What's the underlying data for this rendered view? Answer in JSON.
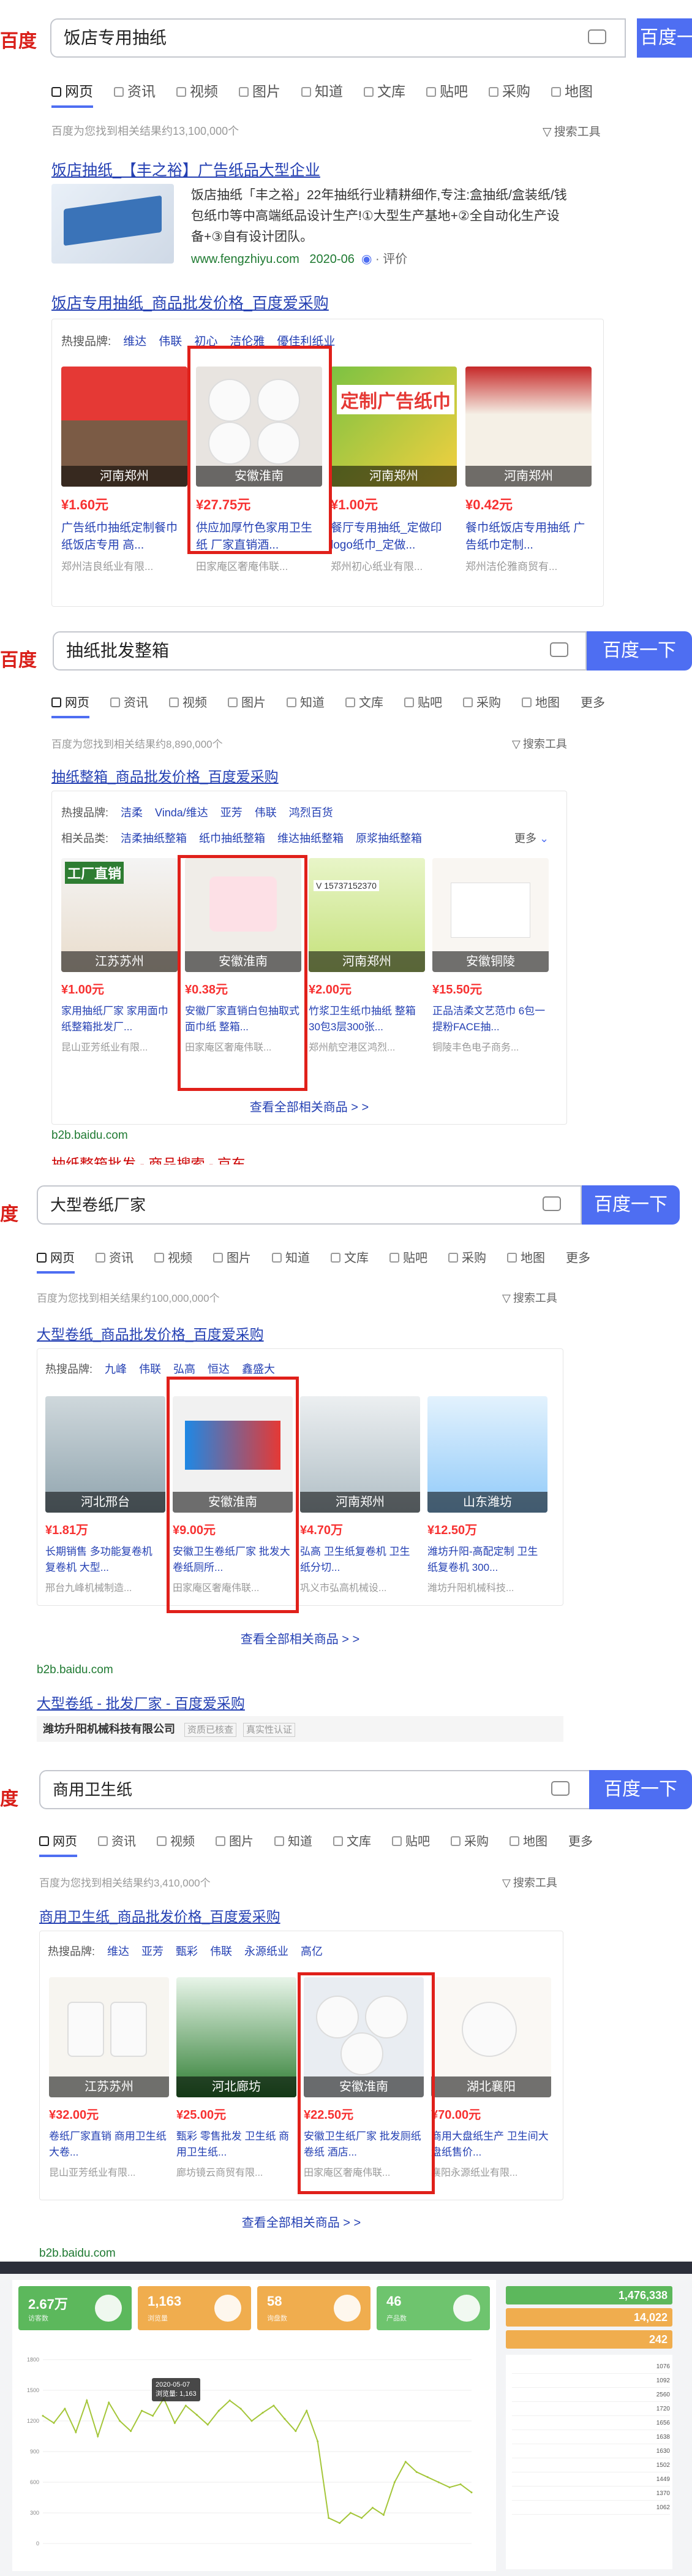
{
  "s1": {
    "logo": "百度",
    "query": "饭店专用抽纸",
    "button": "百度一",
    "tabs": [
      "网页",
      "资讯",
      "视频",
      "图片",
      "知道",
      "文库",
      "贴吧",
      "采购",
      "地图"
    ],
    "result_count": "百度为您找到相关结果约13,100,000个",
    "tools": "搜索工具",
    "ad_title": "饭店抽纸_【丰之裕】广告纸品大型企业",
    "ad_desc1": "饭店抽纸「丰之裕」22年抽纸行业精耕细作,专注:盒抽纸/盒装纸/钱",
    "ad_desc2": "包纸巾等中高端纸品设计生产!①大型生产基地+②全自动化生产设",
    "ad_desc3": "备+③自有设计团队。",
    "ad_url": "www.fengzhiyu.com",
    "ad_date": "2020-06",
    "ad_rate": "评价",
    "b2b_title": "饭店专用抽纸_商品批发价格_百度爱采购",
    "brands_label": "热搜品牌:",
    "brands": [
      "维达",
      "伟联",
      "初心",
      "洁伦雅",
      "優佳利纸业"
    ],
    "products": [
      {
        "loc": "河南郑州",
        "price": "¥1.60元",
        "name": "广告纸巾抽纸定制餐巾纸饭店专用 高...",
        "company": "郑州洁良纸业有限..."
      },
      {
        "loc": "安徽淮南",
        "price": "¥27.75元",
        "name": "供应加厚竹色家用卫生纸 厂家直销酒...",
        "company": "田家庵区奢庵伟联..."
      },
      {
        "loc": "河南郑州",
        "price": "¥1.00元",
        "name": "餐厅专用抽纸_定做印logo纸巾_定做...",
        "company": "郑州初心纸业有限..."
      },
      {
        "loc": "河南郑州",
        "price": "¥0.42元",
        "name": "餐巾纸饭店专用抽纸 广告纸巾定制...",
        "company": "郑州洁伦雅商贸有..."
      }
    ],
    "img_text": "定制广告纸巾"
  },
  "s2": {
    "logo": "百度",
    "query": "抽纸批发整箱",
    "button": "百度一下",
    "tabs": [
      "网页",
      "资讯",
      "视频",
      "图片",
      "知道",
      "文库",
      "贴吧",
      "采购",
      "地图",
      "更多"
    ],
    "result_count": "百度为您找到相关结果约8,890,000个",
    "tools": "搜索工具",
    "b2b_title": "抽纸整箱_商品批发价格_百度爱采购",
    "brands_label": "热搜品牌:",
    "brands": [
      "洁柔",
      "Vinda/维达",
      "亚芳",
      "伟联",
      "鸿烈百货"
    ],
    "related_label": "相关品类:",
    "related": [
      "洁柔抽纸整箱",
      "纸巾抽纸整箱",
      "维达抽纸整箱",
      "原浆抽纸整箱"
    ],
    "more": "更多",
    "products": [
      {
        "loc": "江苏苏州",
        "price": "¥1.00元",
        "name": "家用抽纸厂家 家用面巾纸整箱批发厂...",
        "company": "昆山亚芳纸业有限..."
      },
      {
        "loc": "安徽淮南",
        "price": "¥0.38元",
        "name": "安徽厂家直销白包抽取式面巾纸 整箱...",
        "company": "田家庵区奢庵伟联..."
      },
      {
        "loc": "河南郑州",
        "price": "¥2.00元",
        "name": "竹浆卫生纸巾抽纸 整箱30包3层300张...",
        "company": "郑州航空港区鸿烈..."
      },
      {
        "loc": "安徽铜陵",
        "price": "¥15.50元",
        "name": "正品洁柔文艺范巾 6包一提粉FACE抽...",
        "company": "铜陵丰色电子商务..."
      }
    ],
    "view_all": "查看全部相关商品 > >",
    "src": "b2b.baidu.com",
    "next_title": "抽纸整箱批发 - 商品搜索 - 京东",
    "img_text": "工厂直销",
    "phone": "V 15737152370"
  },
  "s3": {
    "logo": "度",
    "query": "大型卷纸厂家",
    "button": "百度一下",
    "tabs": [
      "网页",
      "资讯",
      "视频",
      "图片",
      "知道",
      "文库",
      "贴吧",
      "采购",
      "地图",
      "更多"
    ],
    "result_count": "百度为您找到相关结果约100,000,000个",
    "tools": "搜索工具",
    "b2b_title": "大型卷纸_商品批发价格_百度爱采购",
    "brands_label": "热搜品牌:",
    "brands": [
      "九峰",
      "伟联",
      "弘高",
      "恒达",
      "鑫盛大"
    ],
    "products": [
      {
        "loc": "河北邢台",
        "price": "¥1.81万",
        "name": "长期销售 多功能复卷机 复卷机 大型...",
        "company": "邢台九峰机械制造..."
      },
      {
        "loc": "安徽淮南",
        "price": "¥9.00元",
        "name": "安徽卫生卷纸厂家 批发大卷纸厕所...",
        "company": "田家庵区奢庵伟联..."
      },
      {
        "loc": "河南郑州",
        "price": "¥4.70万",
        "name": "弘高 卫生纸复卷机 卫生纸分切...",
        "company": "巩义市弘高机械设..."
      },
      {
        "loc": "山东潍坊",
        "price": "¥12.50万",
        "name": "潍坊升阳-高配定制 卫生纸复卷机 300...",
        "company": "潍坊升阳机械科技..."
      }
    ],
    "view_all": "查看全部相关商品 > >",
    "src": "b2b.baidu.com",
    "next_title": "大型卷纸 - 批发厂家 - 百度爱采购",
    "company_name": "潍坊升阳机械科技有限公司",
    "tag1": "资质已核查",
    "tag2": "真实性认证"
  },
  "s4": {
    "logo": "度",
    "query": "商用卫生纸",
    "button": "百度一下",
    "tabs": [
      "网页",
      "资讯",
      "视频",
      "图片",
      "知道",
      "文库",
      "贴吧",
      "采购",
      "地图",
      "更多"
    ],
    "result_count": "百度为您找到相关结果约3,410,000个",
    "tools": "搜索工具",
    "b2b_title": "商用卫生纸_商品批发价格_百度爱采购",
    "brands_label": "热搜品牌:",
    "brands": [
      "维达",
      "亚芳",
      "甄彩",
      "伟联",
      "永源纸业",
      "高亿"
    ],
    "products": [
      {
        "loc": "江苏苏州",
        "price": "¥32.00元",
        "name": "卷纸厂家直销 商用卫生纸 大卷...",
        "company": "昆山亚芳纸业有限..."
      },
      {
        "loc": "河北廊坊",
        "price": "¥25.00元",
        "name": "甄彩 零售批发 卫生纸 商用卫生纸...",
        "company": "廊坊镜云商贸有限..."
      },
      {
        "loc": "安徽淮南",
        "price": "¥22.50元",
        "name": "安徽卫生纸厂家 批发厕纸卷纸 酒店...",
        "company": "田家庵区奢庵伟联..."
      },
      {
        "loc": "湖北襄阳",
        "price": "¥70.00元",
        "name": "商用大盘纸生产 卫生间大盘纸售价...",
        "company": "襄阳永源纸业有限..."
      }
    ],
    "view_all": "查看全部相关商品 > >",
    "src": "b2b.baidu.com"
  },
  "dash": {
    "kpis": [
      {
        "value": "2.67万",
        "label": "访客数",
        "color": "#5cb85c"
      },
      {
        "value": "1,163",
        "label": "浏览量",
        "color": "#f0ad4e"
      },
      {
        "value": "58",
        "label": "询盘数",
        "color": "#f0ad4e"
      },
      {
        "value": "46",
        "label": "产品数",
        "color": "#6ec46e"
      }
    ],
    "stats": [
      {
        "value": "1,476,338",
        "color": "#5cb85c"
      },
      {
        "value": "14,022",
        "color": "#f0ad4e"
      },
      {
        "value": "242",
        "color": "#f0ad4e"
      }
    ],
    "tooltip_title": "2020-05-07",
    "tooltip_value": "浏览量: 1,163",
    "list": [
      "1076",
      "1092",
      "2560",
      "1720",
      "1656",
      "1638",
      "1630",
      "1502",
      "1449",
      "1370",
      "1062"
    ],
    "chart_data": {
      "type": "line",
      "ylim": [
        0,
        1800
      ],
      "yticks": [
        "0",
        "300",
        "600",
        "900",
        "1200",
        "1500",
        "1800"
      ],
      "values": [
        1250,
        1180,
        1320,
        1090,
        1400,
        1050,
        1380,
        1200,
        1100,
        1300,
        1250,
        1420,
        1180,
        1350,
        1260,
        1163,
        1300,
        1400,
        1320,
        1200,
        1280,
        1350,
        1220,
        1100,
        1300,
        1000,
        250,
        200,
        300,
        250,
        350,
        280,
        600,
        800,
        700,
        650,
        600,
        550,
        580,
        500
      ]
    }
  }
}
